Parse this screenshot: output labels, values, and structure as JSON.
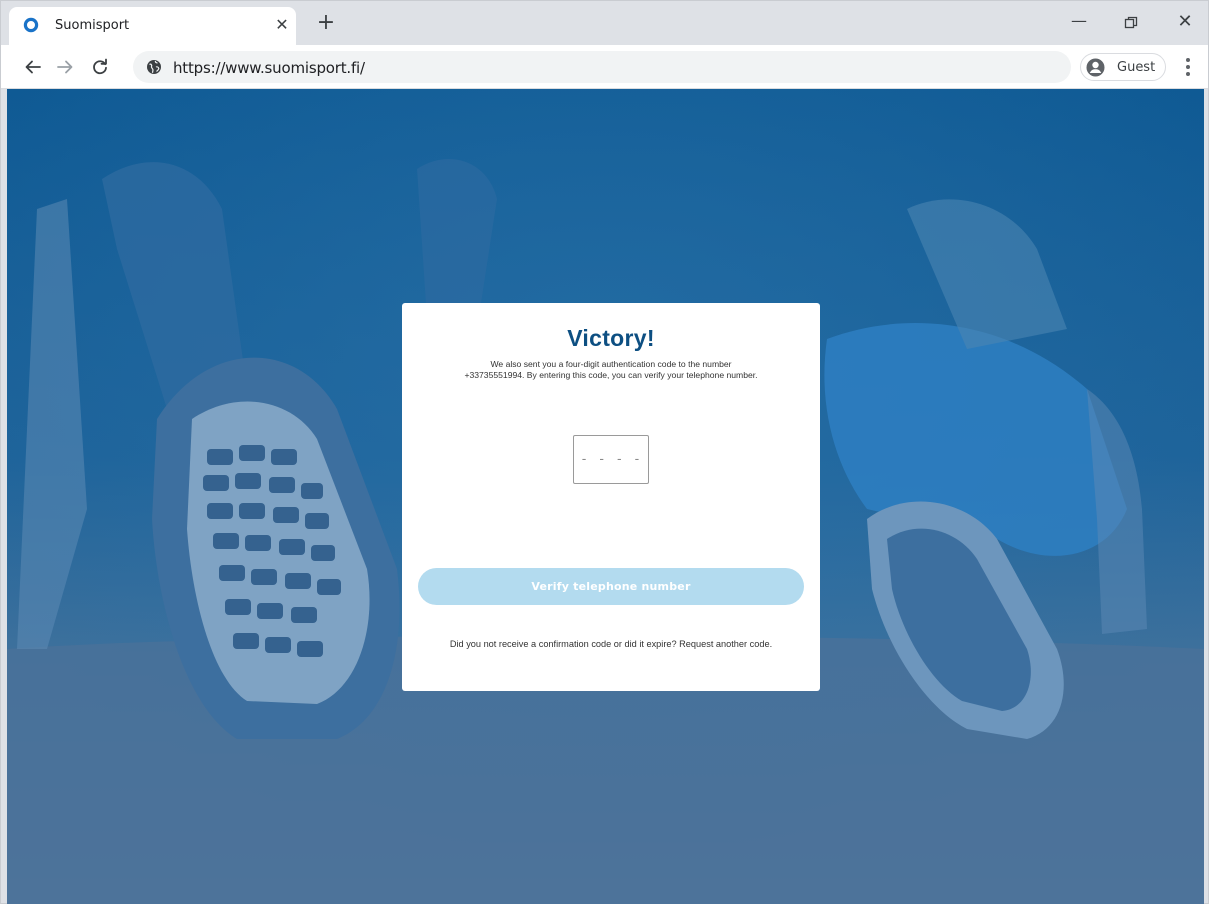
{
  "browser": {
    "tab": {
      "title": "Suomisport",
      "close_glyph": "✕",
      "favicon": "suomisport-ring-icon"
    },
    "new_tab_glyph": "+",
    "window_controls": {
      "minimize_glyph": "—",
      "restore_icon": "restore-icon",
      "close_glyph": "✕"
    },
    "toolbar": {
      "back_icon": "arrow-left-icon",
      "forward_icon": "arrow-right-icon",
      "reload_icon": "reload-icon",
      "site_info_icon": "globe-icon",
      "url": "https://www.suomisport.fi/",
      "profile_label": "Guest",
      "profile_icon": "account-circle-icon",
      "menu_icon": "kebab-menu-icon"
    }
  },
  "page": {
    "background_tint": "#1c5c90",
    "verification_card": {
      "title": "Victory!",
      "description_line1": "We also sent you a four-digit authentication code to the number",
      "description_line2": "+33735551994. By entering this code, you can verify your telephone number.",
      "code_input_value": "",
      "code_input_placeholder": "- - - -",
      "verify_button_label": "Verify telephone number",
      "resend_text": "Did you not receive a confirmation code or did it expire? Request another code.",
      "title_color": "#0d4f82",
      "button_color": "#b3dbef"
    }
  }
}
